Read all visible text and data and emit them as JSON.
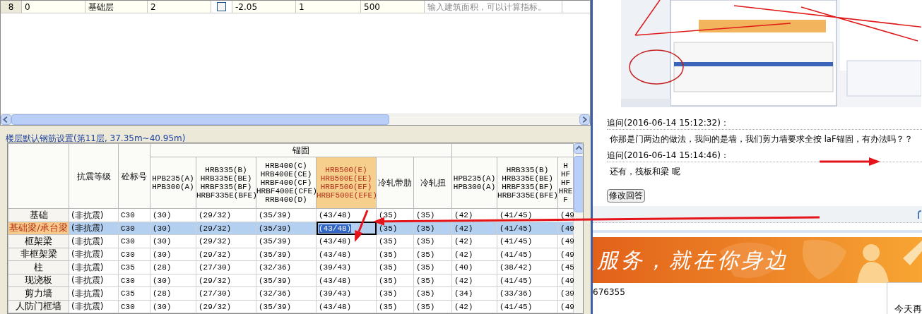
{
  "floor_table": {
    "rows": [
      {
        "number": "8",
        "cells": [
          {
            "kind": "text",
            "text": "0"
          },
          {
            "kind": "text",
            "text": "基础层"
          },
          {
            "kind": "text",
            "text": "2"
          },
          {
            "kind": "checkbox",
            "checked": false
          },
          {
            "kind": "text",
            "text": "-2.05"
          },
          {
            "kind": "text",
            "text": "1"
          },
          {
            "kind": "text",
            "text": "500"
          },
          {
            "kind": "hint",
            "text": "输入建筑面积，可以计算指标。"
          }
        ]
      }
    ]
  },
  "rebar_settings": {
    "title": "楼层默认钢筋设置(第11层, 37.35m~40.95m)",
    "fixed_columns": [
      "抗震等级",
      "砼标号"
    ],
    "groups": [
      {
        "label": "锚固",
        "columns": [
          {
            "lines": [
              "HPB235(A)",
              "HPB300(A)"
            ],
            "selected": false
          },
          {
            "lines": [
              "HRB335(B)",
              "HRB335E(BE)",
              "HRBF335(BF)",
              "HRBF335E(BFE)"
            ],
            "selected": false
          },
          {
            "lines": [
              "HRB400(C)",
              "HRB400E(CE)",
              "HRBF400(CF)",
              "HRBF400E(CFE)",
              "RRB400(D)"
            ],
            "selected": false
          },
          {
            "lines": [
              "HRB500(E)",
              "HRB500E(EE)",
              "HRBF500(EF)",
              "HRBF500E(EFE)"
            ],
            "selected": true
          },
          {
            "lines": [
              "冷轧带肋"
            ],
            "selected": false
          },
          {
            "lines": [
              "冷轧扭"
            ],
            "selected": false
          }
        ]
      },
      {
        "columns": [
          {
            "lines": [
              "HPB235(A)",
              "HPB300(A)"
            ],
            "selected": false
          },
          {
            "lines": [
              "HRB335(B)",
              "HRB335E(BE)",
              "HRBF335(BF)",
              "HRBF335E(BFE)"
            ],
            "selected": false
          },
          {
            "lines": [
              "H",
              "HF",
              "HF",
              "HRE",
              "F"
            ],
            "selected": false
          }
        ]
      }
    ],
    "rows": [
      {
        "name": "基础",
        "selected": false,
        "cells": [
          "(非抗震)",
          "C30",
          "(30)",
          "(29/32)",
          "(35/39)",
          "(43/48)",
          "(35)",
          "(35)",
          "(42)",
          "(41/45)",
          "(49"
        ]
      },
      {
        "name": "基础梁/承台梁",
        "selected": true,
        "cells": [
          "(非抗震)",
          "C30",
          "(30)",
          "(29/32)",
          "(35/39)",
          "(43/48)",
          "(35)",
          "(35)",
          "(42)",
          "(41/45)",
          "(49"
        ]
      },
      {
        "name": "框架梁",
        "selected": false,
        "cells": [
          "(非抗震)",
          "C30",
          "(30)",
          "(29/32)",
          "(35/39)",
          "(43/48)",
          "(35)",
          "(35)",
          "(42)",
          "(41/45)",
          "(49"
        ]
      },
      {
        "name": "非框架梁",
        "selected": false,
        "cells": [
          "(非抗震)",
          "C30",
          "(30)",
          "(29/32)",
          "(35/39)",
          "(43/48)",
          "(35)",
          "(35)",
          "(42)",
          "(41/45)",
          "(49"
        ]
      },
      {
        "name": "柱",
        "selected": false,
        "cells": [
          "(非抗震)",
          "C35",
          "(28)",
          "(27/30)",
          "(32/36)",
          "(39/43)",
          "(35)",
          "(35)",
          "(40)",
          "(38/42)",
          "(45"
        ]
      },
      {
        "name": "现浇板",
        "selected": false,
        "cells": [
          "(非抗震)",
          "C30",
          "(30)",
          "(29/32)",
          "(35/39)",
          "(43/48)",
          "(35)",
          "(35)",
          "(42)",
          "(41/45)",
          "(49"
        ]
      },
      {
        "name": "剪力墙",
        "selected": false,
        "cells": [
          "(非抗震)",
          "C35",
          "(28)",
          "(27/30)",
          "(32/36)",
          "(39/43)",
          "(35)",
          "(35)",
          "(34)",
          "(33/36)",
          "(39"
        ]
      },
      {
        "name": "人防门框墙",
        "selected": false,
        "cells": [
          "(非抗震)",
          "C30",
          "(30)",
          "(29/32)",
          "(35/39)",
          "(43/48)",
          "(35)",
          "(35)",
          "(42)",
          "(41/45)",
          "(49"
        ]
      }
    ]
  },
  "answer_page": {
    "followups": [
      {
        "label": "追问(2016-06-14 15:12:32)：",
        "text": "你那是门两边的做法，我问的是墙，我们剪力墙要求全按 laF锚固，有办法吗？？"
      },
      {
        "label": "追问(2016-06-14 15:14:46)：",
        "text": "还有，筏板和梁 呢"
      }
    ],
    "edit_button": "修改回答",
    "banner": {
      "slogan": "服务，就在你身边"
    },
    "phone_fragment": "676355",
    "popup": {
      "text": "今天再"
    }
  }
}
